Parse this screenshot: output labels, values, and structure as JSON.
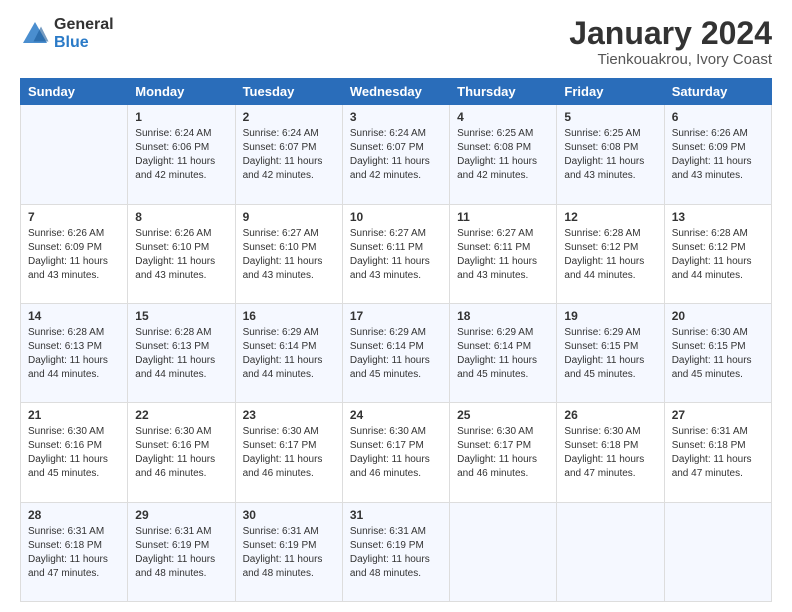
{
  "header": {
    "logo_general": "General",
    "logo_blue": "Blue",
    "main_title": "January 2024",
    "subtitle": "Tienkouakrou, Ivory Coast"
  },
  "calendar": {
    "days_of_week": [
      "Sunday",
      "Monday",
      "Tuesday",
      "Wednesday",
      "Thursday",
      "Friday",
      "Saturday"
    ],
    "weeks": [
      [
        {
          "day": "",
          "info": ""
        },
        {
          "day": "1",
          "info": "Sunrise: 6:24 AM\nSunset: 6:06 PM\nDaylight: 11 hours\nand 42 minutes."
        },
        {
          "day": "2",
          "info": "Sunrise: 6:24 AM\nSunset: 6:07 PM\nDaylight: 11 hours\nand 42 minutes."
        },
        {
          "day": "3",
          "info": "Sunrise: 6:24 AM\nSunset: 6:07 PM\nDaylight: 11 hours\nand 42 minutes."
        },
        {
          "day": "4",
          "info": "Sunrise: 6:25 AM\nSunset: 6:08 PM\nDaylight: 11 hours\nand 42 minutes."
        },
        {
          "day": "5",
          "info": "Sunrise: 6:25 AM\nSunset: 6:08 PM\nDaylight: 11 hours\nand 43 minutes."
        },
        {
          "day": "6",
          "info": "Sunrise: 6:26 AM\nSunset: 6:09 PM\nDaylight: 11 hours\nand 43 minutes."
        }
      ],
      [
        {
          "day": "7",
          "info": "Sunrise: 6:26 AM\nSunset: 6:09 PM\nDaylight: 11 hours\nand 43 minutes."
        },
        {
          "day": "8",
          "info": "Sunrise: 6:26 AM\nSunset: 6:10 PM\nDaylight: 11 hours\nand 43 minutes."
        },
        {
          "day": "9",
          "info": "Sunrise: 6:27 AM\nSunset: 6:10 PM\nDaylight: 11 hours\nand 43 minutes."
        },
        {
          "day": "10",
          "info": "Sunrise: 6:27 AM\nSunset: 6:11 PM\nDaylight: 11 hours\nand 43 minutes."
        },
        {
          "day": "11",
          "info": "Sunrise: 6:27 AM\nSunset: 6:11 PM\nDaylight: 11 hours\nand 43 minutes."
        },
        {
          "day": "12",
          "info": "Sunrise: 6:28 AM\nSunset: 6:12 PM\nDaylight: 11 hours\nand 44 minutes."
        },
        {
          "day": "13",
          "info": "Sunrise: 6:28 AM\nSunset: 6:12 PM\nDaylight: 11 hours\nand 44 minutes."
        }
      ],
      [
        {
          "day": "14",
          "info": "Sunrise: 6:28 AM\nSunset: 6:13 PM\nDaylight: 11 hours\nand 44 minutes."
        },
        {
          "day": "15",
          "info": "Sunrise: 6:28 AM\nSunset: 6:13 PM\nDaylight: 11 hours\nand 44 minutes."
        },
        {
          "day": "16",
          "info": "Sunrise: 6:29 AM\nSunset: 6:14 PM\nDaylight: 11 hours\nand 44 minutes."
        },
        {
          "day": "17",
          "info": "Sunrise: 6:29 AM\nSunset: 6:14 PM\nDaylight: 11 hours\nand 45 minutes."
        },
        {
          "day": "18",
          "info": "Sunrise: 6:29 AM\nSunset: 6:14 PM\nDaylight: 11 hours\nand 45 minutes."
        },
        {
          "day": "19",
          "info": "Sunrise: 6:29 AM\nSunset: 6:15 PM\nDaylight: 11 hours\nand 45 minutes."
        },
        {
          "day": "20",
          "info": "Sunrise: 6:30 AM\nSunset: 6:15 PM\nDaylight: 11 hours\nand 45 minutes."
        }
      ],
      [
        {
          "day": "21",
          "info": "Sunrise: 6:30 AM\nSunset: 6:16 PM\nDaylight: 11 hours\nand 45 minutes."
        },
        {
          "day": "22",
          "info": "Sunrise: 6:30 AM\nSunset: 6:16 PM\nDaylight: 11 hours\nand 46 minutes."
        },
        {
          "day": "23",
          "info": "Sunrise: 6:30 AM\nSunset: 6:17 PM\nDaylight: 11 hours\nand 46 minutes."
        },
        {
          "day": "24",
          "info": "Sunrise: 6:30 AM\nSunset: 6:17 PM\nDaylight: 11 hours\nand 46 minutes."
        },
        {
          "day": "25",
          "info": "Sunrise: 6:30 AM\nSunset: 6:17 PM\nDaylight: 11 hours\nand 46 minutes."
        },
        {
          "day": "26",
          "info": "Sunrise: 6:30 AM\nSunset: 6:18 PM\nDaylight: 11 hours\nand 47 minutes."
        },
        {
          "day": "27",
          "info": "Sunrise: 6:31 AM\nSunset: 6:18 PM\nDaylight: 11 hours\nand 47 minutes."
        }
      ],
      [
        {
          "day": "28",
          "info": "Sunrise: 6:31 AM\nSunset: 6:18 PM\nDaylight: 11 hours\nand 47 minutes."
        },
        {
          "day": "29",
          "info": "Sunrise: 6:31 AM\nSunset: 6:19 PM\nDaylight: 11 hours\nand 48 minutes."
        },
        {
          "day": "30",
          "info": "Sunrise: 6:31 AM\nSunset: 6:19 PM\nDaylight: 11 hours\nand 48 minutes."
        },
        {
          "day": "31",
          "info": "Sunrise: 6:31 AM\nSunset: 6:19 PM\nDaylight: 11 hours\nand 48 minutes."
        },
        {
          "day": "",
          "info": ""
        },
        {
          "day": "",
          "info": ""
        },
        {
          "day": "",
          "info": ""
        }
      ]
    ]
  }
}
